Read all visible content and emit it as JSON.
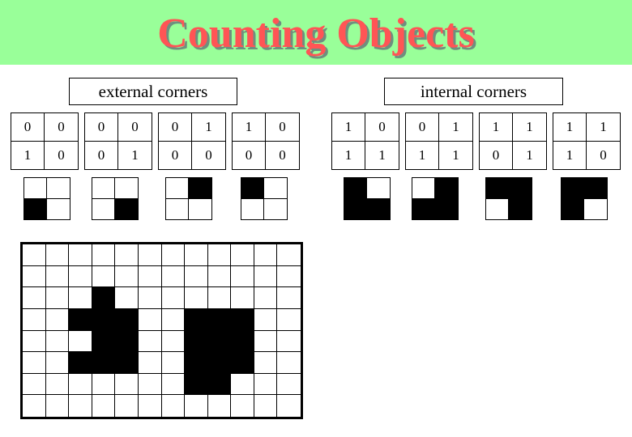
{
  "title": "Counting Objects",
  "colors": {
    "header_bg": "#99ff99",
    "title": "#ff5555",
    "filled": "#000000",
    "empty": "#ffffff"
  },
  "sections": {
    "external": {
      "label": "external corners",
      "patterns": [
        {
          "values": [
            "0",
            "0",
            "1",
            "0"
          ],
          "filled": [
            false,
            false,
            true,
            false
          ]
        },
        {
          "values": [
            "0",
            "0",
            "0",
            "1"
          ],
          "filled": [
            false,
            false,
            false,
            true
          ]
        },
        {
          "values": [
            "0",
            "1",
            "0",
            "0"
          ],
          "filled": [
            false,
            true,
            false,
            false
          ]
        },
        {
          "values": [
            "1",
            "0",
            "0",
            "0"
          ],
          "filled": [
            true,
            false,
            false,
            false
          ]
        }
      ]
    },
    "internal": {
      "label": "internal corners",
      "patterns": [
        {
          "values": [
            "1",
            "0",
            "1",
            "1"
          ],
          "filled": [
            true,
            false,
            true,
            true
          ]
        },
        {
          "values": [
            "0",
            "1",
            "1",
            "1"
          ],
          "filled": [
            false,
            true,
            true,
            true
          ]
        },
        {
          "values": [
            "1",
            "1",
            "0",
            "1"
          ],
          "filled": [
            true,
            true,
            false,
            true
          ]
        },
        {
          "values": [
            "1",
            "1",
            "1",
            "0"
          ],
          "filled": [
            true,
            true,
            true,
            false
          ]
        }
      ]
    }
  },
  "image_grid": {
    "rows": 8,
    "cols": 12,
    "cells": [
      [
        0,
        0,
        0,
        0,
        0,
        0,
        0,
        0,
        0,
        0,
        0,
        0
      ],
      [
        0,
        0,
        0,
        0,
        0,
        0,
        0,
        0,
        0,
        0,
        0,
        0
      ],
      [
        0,
        0,
        0,
        1,
        0,
        0,
        0,
        0,
        0,
        0,
        0,
        0
      ],
      [
        0,
        0,
        1,
        1,
        1,
        0,
        0,
        1,
        1,
        1,
        0,
        0
      ],
      [
        0,
        0,
        0,
        1,
        1,
        0,
        0,
        1,
        1,
        1,
        0,
        0
      ],
      [
        0,
        0,
        1,
        1,
        1,
        0,
        0,
        1,
        1,
        1,
        0,
        0
      ],
      [
        0,
        0,
        0,
        0,
        0,
        0,
        0,
        1,
        1,
        0,
        0,
        0
      ],
      [
        0,
        0,
        0,
        0,
        0,
        0,
        0,
        0,
        0,
        0,
        0,
        0
      ]
    ]
  }
}
